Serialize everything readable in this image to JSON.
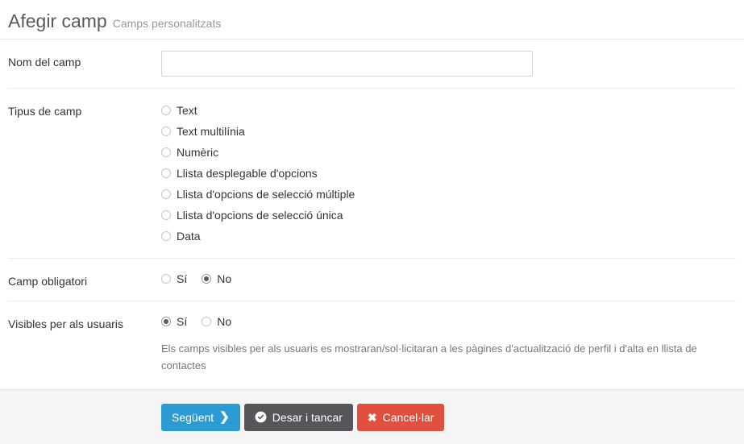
{
  "header": {
    "title": "Afegir camp",
    "subtitle": "Camps personalitzats"
  },
  "form": {
    "field_name": {
      "label": "Nom del camp",
      "value": "",
      "placeholder": ""
    },
    "field_type": {
      "label": "Tipus de camp",
      "options": [
        {
          "label": "Text",
          "selected": false
        },
        {
          "label": "Text multilínia",
          "selected": false
        },
        {
          "label": "Numèric",
          "selected": false
        },
        {
          "label": "Llista desplegable d'opcions",
          "selected": false
        },
        {
          "label": "Llista d'opcions de selecció múltiple",
          "selected": false
        },
        {
          "label": "Llista d'opcions de selecció única",
          "selected": false
        },
        {
          "label": "Data",
          "selected": false
        }
      ]
    },
    "required": {
      "label": "Camp obligatori",
      "options": [
        {
          "label": "Sí",
          "selected": false
        },
        {
          "label": "No",
          "selected": true
        }
      ]
    },
    "visible": {
      "label": "Visibles per als usuaris",
      "options": [
        {
          "label": "Sí",
          "selected": true
        },
        {
          "label": "No",
          "selected": false
        }
      ],
      "help": "Els camps visibles per als usuaris es mostraran/sol·licitaran a les pàgines d'actualització de perfil i d'alta en llista de contactes"
    }
  },
  "footer": {
    "buttons": [
      {
        "label": "Següent",
        "icon": "chevron-right-icon",
        "icon_glyph": "❯",
        "icon_position": "after",
        "color": "#2b9bd3"
      },
      {
        "label": "Desar i tancar",
        "icon": "check-circle-icon",
        "icon_glyph": "",
        "icon_position": "before",
        "color": "#55565a"
      },
      {
        "label": "Cancel·lar",
        "icon": "times-icon",
        "icon_glyph": "✖",
        "icon_position": "before",
        "color": "#e0503c"
      }
    ]
  }
}
